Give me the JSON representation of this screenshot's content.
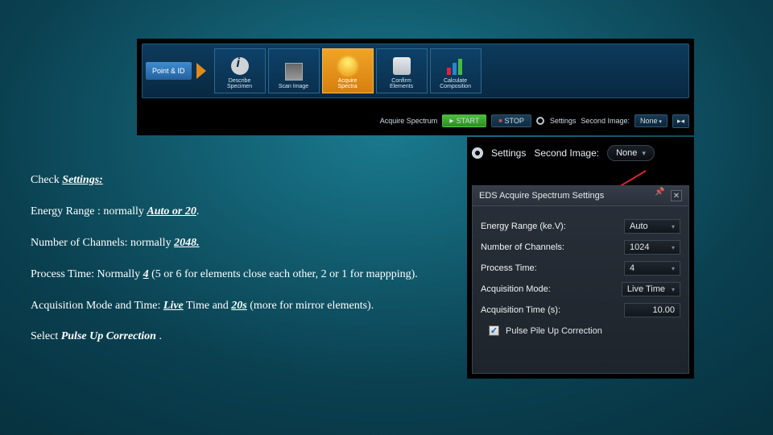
{
  "workflow": {
    "point_tag": "Point & ID",
    "steps": [
      {
        "label1": "Describe",
        "label2": "Specimen"
      },
      {
        "label1": "Scan Image",
        "label2": ""
      },
      {
        "label1": "Acquire",
        "label2": "Spectra"
      },
      {
        "label1": "Confirm",
        "label2": "Elements"
      },
      {
        "label1": "Calculate",
        "label2": "Composition"
      }
    ],
    "acquire_label": "Acquire Spectrum",
    "start": "START",
    "stop": "STOP",
    "settings": "Settings",
    "second_image": "Second Image:",
    "second_image_value": "None",
    "pager": "▸◂"
  },
  "sbar": {
    "settings": "Settings",
    "second_image": "Second Image:",
    "second_image_value": "None"
  },
  "panel": {
    "title": "EDS Acquire Spectrum Settings",
    "rows": {
      "energy_range_label": "Energy Range (ke.V):",
      "energy_range_value": "Auto",
      "channels_label": "Number of Channels:",
      "channels_value": "1024",
      "process_time_label": "Process Time:",
      "process_time_value": "4",
      "acq_mode_label": "Acquisition Mode:",
      "acq_mode_value": "Live Time",
      "acq_time_label": "Acquisition Time (s):",
      "acq_time_value": "10.00"
    },
    "checkbox_label": "Pulse Pile Up Correction"
  },
  "inst": {
    "l1a": "Check ",
    "l1b": "Settings:",
    "l2a": "Energy Range : normally ",
    "l2b": "Auto or 20",
    "l2c": ".",
    "l3a": "Number of Channels: normally ",
    "l3b": "2048.",
    "l4a": "Process Time: Normally ",
    "l4b": "4",
    "l4c": " (5 or 6 for elements close each other, 2 or 1 for mappping).",
    "l5a": "Acquisition Mode and Time: ",
    "l5b": "Live",
    "l5c": " Time and ",
    "l5d": "20s",
    "l5e": " (more for mirror elements).",
    "l6a": "Select ",
    "l6b": "Pulse Up Correction",
    "l6c": " ."
  }
}
